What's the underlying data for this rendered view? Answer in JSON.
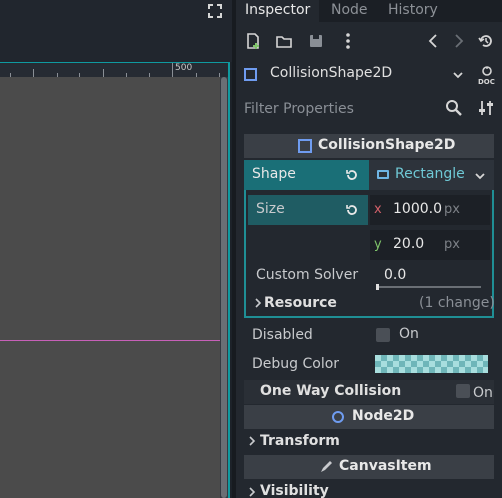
{
  "viewport": {
    "ruler_label": "500"
  },
  "inspector": {
    "tabs": [
      "Inspector",
      "Node",
      "History"
    ],
    "node_name": "CollisionShape2D",
    "filter_placeholder": "Filter Properties",
    "section_collision": "CollisionShape2D",
    "shape": {
      "label": "Shape",
      "value": "Rectangle"
    },
    "size": {
      "label": "Size",
      "x_axis": "x",
      "x_value": "1000.0",
      "x_unit": "px",
      "y_axis": "y",
      "y_value": "20.0",
      "y_unit": "px"
    },
    "custom_solver": {
      "label": "Custom Solver",
      "value": "0.0"
    },
    "resource": {
      "label": "Resource",
      "changes": "(1 change)"
    },
    "disabled": {
      "label": "Disabled",
      "value": "On"
    },
    "debug_color": {
      "label": "Debug Color"
    },
    "one_way": {
      "label": "One Way Collision",
      "value": "On"
    },
    "section_node2d": "Node2D",
    "transform": "Transform",
    "section_canvasitem": "CanvasItem",
    "visibility": "Visibility"
  },
  "colors": {
    "accent_teal": "#0f9aa0",
    "node_blue": "#6f9cf0",
    "axis_x": "#d2606a",
    "axis_y": "#7fc46a"
  }
}
